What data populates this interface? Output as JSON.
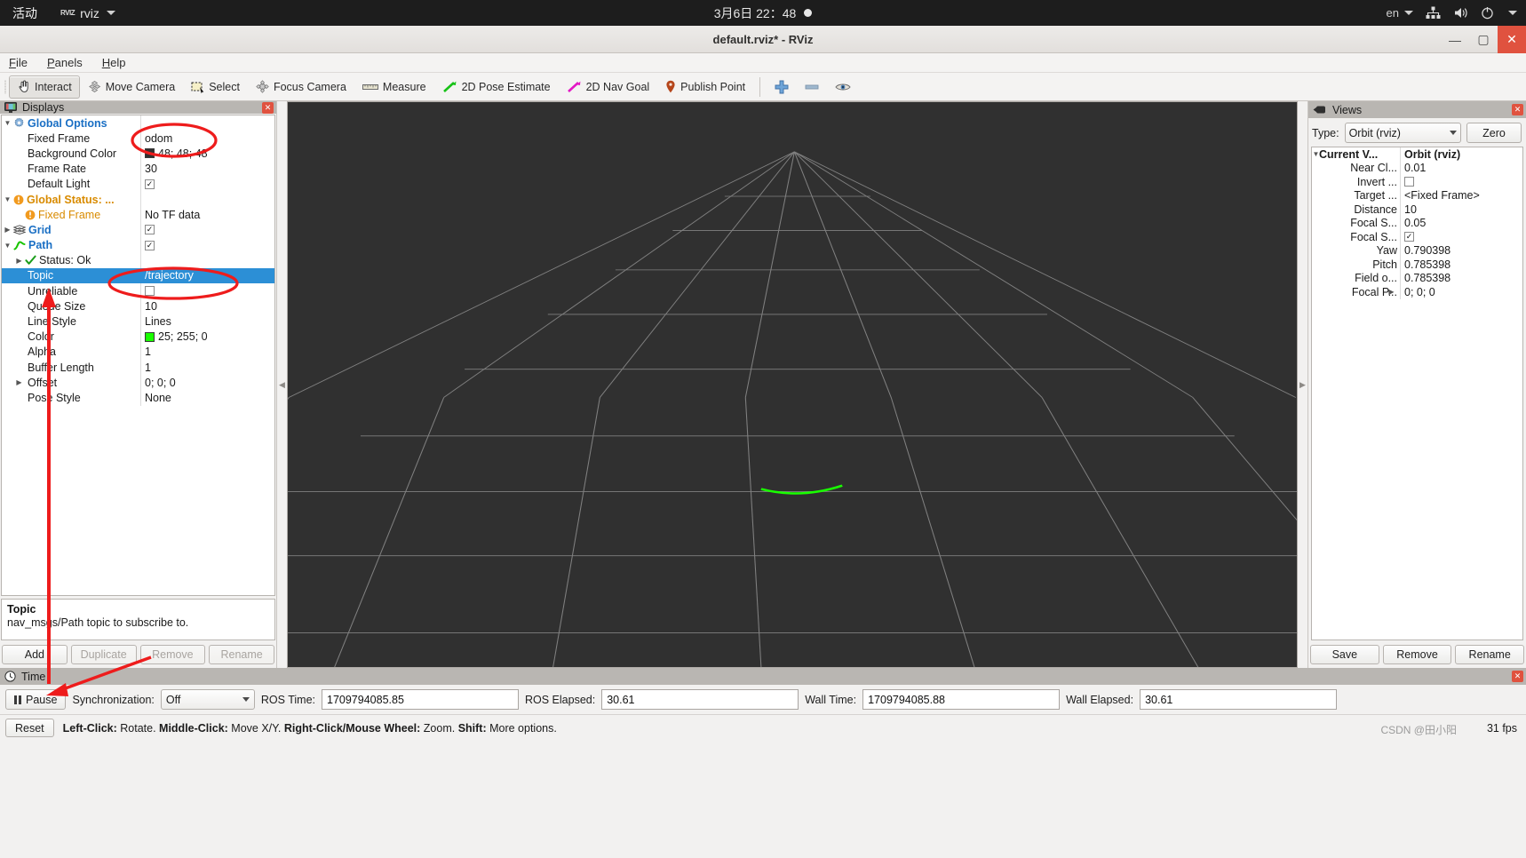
{
  "gnome": {
    "activities": "活动",
    "app_name": "rviz",
    "app_badge": "RVIZ",
    "clock": "3月6日  22：48",
    "language": "en"
  },
  "window": {
    "title": "default.rviz* - RViz",
    "minimize": "—",
    "maximize": "▢",
    "close": "✕"
  },
  "menubar": [
    {
      "label": "File",
      "mnemonic": "F"
    },
    {
      "label": "Panels",
      "mnemonic": "P"
    },
    {
      "label": "Help",
      "mnemonic": "H"
    }
  ],
  "toolbar": {
    "buttons": [
      {
        "label": "Interact",
        "icon": "hand-cursor-icon",
        "active": true
      },
      {
        "label": "Move Camera",
        "icon": "move-camera-icon",
        "active": false
      },
      {
        "label": "Select",
        "icon": "select-rectangle-icon",
        "active": false
      },
      {
        "label": "Focus Camera",
        "icon": "focus-camera-icon",
        "active": false
      },
      {
        "label": "Measure",
        "icon": "ruler-icon",
        "active": false
      },
      {
        "label": "2D Pose Estimate",
        "icon": "green-arrow-icon",
        "active": false
      },
      {
        "label": "2D Nav Goal",
        "icon": "magenta-arrow-icon",
        "active": false
      },
      {
        "label": "Publish Point",
        "icon": "map-pin-icon",
        "active": false
      }
    ],
    "extra_icons": [
      "plus-icon",
      "minus-icon",
      "eye-icon"
    ]
  },
  "displays": {
    "title": "Displays",
    "rows": [
      {
        "indent": 0,
        "expander": "▼",
        "icon": "gear-icon",
        "name": "Global Options",
        "style": "bold-blue",
        "value": "",
        "value_type": "none"
      },
      {
        "indent": 1,
        "expander": "",
        "icon": "",
        "name": "Fixed Frame",
        "style": "plain",
        "value": "odom",
        "value_type": "text"
      },
      {
        "indent": 1,
        "expander": "",
        "icon": "",
        "name": "Background Color",
        "style": "plain",
        "value": "48; 48; 48",
        "value_type": "swatch",
        "swatch_color": "#303030"
      },
      {
        "indent": 1,
        "expander": "",
        "icon": "",
        "name": "Frame Rate",
        "style": "plain",
        "value": "30",
        "value_type": "text"
      },
      {
        "indent": 1,
        "expander": "",
        "icon": "",
        "name": "Default Light",
        "style": "plain",
        "value": "✓",
        "value_type": "checkbox"
      },
      {
        "indent": 0,
        "expander": "▼",
        "icon": "warning-icon",
        "name": "Global Status: ...",
        "style": "bold-orange",
        "value": "",
        "value_type": "none"
      },
      {
        "indent": 1,
        "expander": "",
        "icon": "warning-icon",
        "name": "Fixed Frame",
        "style": "orange",
        "value": "No TF data",
        "value_type": "text"
      },
      {
        "indent": 0,
        "expander": "▶",
        "icon": "grid-icon",
        "name": "Grid",
        "style": "bold-blue",
        "value": "✓",
        "value_type": "checkbox"
      },
      {
        "indent": 0,
        "expander": "▼",
        "icon": "path-icon",
        "name": "Path",
        "style": "bold-blue",
        "value": "✓",
        "value_type": "checkbox"
      },
      {
        "indent": 1,
        "expander": "▶",
        "icon": "check-icon",
        "name": "Status: Ok",
        "style": "plain",
        "value": "",
        "value_type": "none"
      },
      {
        "indent": 1,
        "expander": "",
        "icon": "",
        "name": "Topic",
        "style": "plain",
        "value": "/trajectory",
        "value_type": "text",
        "selected": true
      },
      {
        "indent": 1,
        "expander": "",
        "icon": "",
        "name": "Unreliable",
        "style": "plain",
        "value": "",
        "value_type": "checkbox"
      },
      {
        "indent": 1,
        "expander": "",
        "icon": "",
        "name": "Queue Size",
        "style": "plain",
        "value": "10",
        "value_type": "text"
      },
      {
        "indent": 1,
        "expander": "",
        "icon": "",
        "name": "Line Style",
        "style": "plain",
        "value": "Lines",
        "value_type": "text"
      },
      {
        "indent": 1,
        "expander": "",
        "icon": "",
        "name": "Color",
        "style": "plain",
        "value": "25; 255; 0",
        "value_type": "swatch",
        "swatch_color": "#19ff00"
      },
      {
        "indent": 1,
        "expander": "",
        "icon": "",
        "name": "Alpha",
        "style": "plain",
        "value": "1",
        "value_type": "text"
      },
      {
        "indent": 1,
        "expander": "",
        "icon": "",
        "name": "Buffer Length",
        "style": "plain",
        "value": "1",
        "value_type": "text"
      },
      {
        "indent": 1,
        "expander": "▶",
        "icon": "",
        "name": "Offset",
        "style": "plain",
        "value": "0; 0; 0",
        "value_type": "text"
      },
      {
        "indent": 1,
        "expander": "",
        "icon": "",
        "name": "Pose Style",
        "style": "plain",
        "value": "None",
        "value_type": "text"
      }
    ],
    "description": {
      "title": "Topic",
      "text": "nav_msgs/Path topic to subscribe to."
    },
    "buttons": [
      {
        "label": "Add",
        "enabled": true
      },
      {
        "label": "Duplicate",
        "enabled": false
      },
      {
        "label": "Remove",
        "enabled": false
      },
      {
        "label": "Rename",
        "enabled": false
      }
    ]
  },
  "views": {
    "title": "Views",
    "type_label": "Type:",
    "type_value": "Orbit (rviz)",
    "zero_label": "Zero",
    "rows": [
      {
        "indent": 0,
        "expander": "▼",
        "name": "Current V...",
        "value": "Orbit (rviz)",
        "value_type": "text",
        "head": true
      },
      {
        "indent": 1,
        "expander": "",
        "name": "Near Cl...",
        "value": "0.01",
        "value_type": "text"
      },
      {
        "indent": 1,
        "expander": "",
        "name": "Invert ...",
        "value": "",
        "value_type": "checkbox"
      },
      {
        "indent": 1,
        "expander": "",
        "name": "Target ...",
        "value": "<Fixed Frame>",
        "value_type": "text"
      },
      {
        "indent": 1,
        "expander": "",
        "name": "Distance",
        "value": "10",
        "value_type": "text"
      },
      {
        "indent": 1,
        "expander": "",
        "name": "Focal S...",
        "value": "0.05",
        "value_type": "text"
      },
      {
        "indent": 1,
        "expander": "",
        "name": "Focal S...",
        "value": "✓",
        "value_type": "checkbox"
      },
      {
        "indent": 1,
        "expander": "",
        "name": "Yaw",
        "value": "0.790398",
        "value_type": "text"
      },
      {
        "indent": 1,
        "expander": "",
        "name": "Pitch",
        "value": "0.785398",
        "value_type": "text"
      },
      {
        "indent": 1,
        "expander": "",
        "name": "Field o...",
        "value": "0.785398",
        "value_type": "text"
      },
      {
        "indent": 1,
        "expander": "▶",
        "name": "Focal P...",
        "value": "0; 0; 0",
        "value_type": "text"
      }
    ],
    "buttons": [
      {
        "label": "Save"
      },
      {
        "label": "Remove"
      },
      {
        "label": "Rename"
      }
    ]
  },
  "time": {
    "title": "Time",
    "pause_label": "Pause",
    "sync_label": "Synchronization:",
    "sync_value": "Off",
    "fields": [
      {
        "label": "ROS Time:",
        "value": "1709794085.85"
      },
      {
        "label": "ROS Elapsed:",
        "value": "30.61"
      },
      {
        "label": "Wall Time:",
        "value": "1709794085.88"
      },
      {
        "label": "Wall Elapsed:",
        "value": "30.61"
      }
    ]
  },
  "statusbar": {
    "reset_label": "Reset",
    "hint_parts": [
      {
        "bold": "Left-Click:",
        "text": " Rotate. "
      },
      {
        "bold": "Middle-Click:",
        "text": " Move X/Y. "
      },
      {
        "bold": "Right-Click/Mouse Wheel:",
        "text": " Zoom. "
      },
      {
        "bold": "Shift:",
        "text": " More options."
      }
    ],
    "fps": "31 fps",
    "watermark": "CSDN @田小阳"
  },
  "colors": {
    "selection_blue": "#2c8fd6",
    "path_green": "#19ff00",
    "annotation_red": "#ee1c1c",
    "viewport_bg": "#303030",
    "grid_line": "#9a9a9a"
  }
}
